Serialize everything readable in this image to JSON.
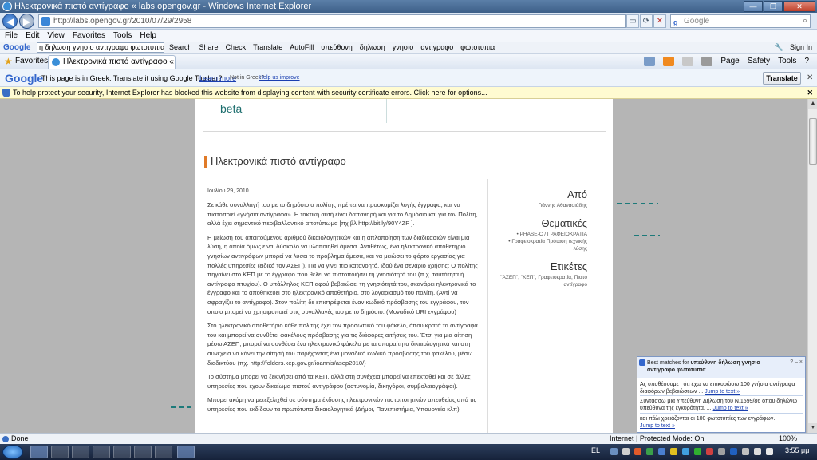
{
  "window": {
    "title": "Ηλεκτρονικά πιστό αντίγραφο « labs.opengov.gr - Windows Internet Explorer"
  },
  "address": {
    "url": "http://labs.opengov.gr/2010/07/29/2958"
  },
  "search_box": {
    "placeholder": "Google"
  },
  "menu": [
    "File",
    "Edit",
    "View",
    "Favorites",
    "Tools",
    "Help"
  ],
  "google_toolbar": {
    "logo": "Google",
    "query": "η δηλωση γνησιο αντιγραφο φωτοτυπια",
    "items": [
      "Search",
      "Share",
      "Check",
      "Translate",
      "AutoFill",
      "υπεύθυνη",
      "δηλωση",
      "γνησιο",
      "αντιγραφο",
      "φωτοτυπια"
    ],
    "sign_in": "Sign In"
  },
  "favorites_bar": {
    "favorites_label": "Favorites",
    "tab_title": "Ηλεκτρονικά πιστό αντίγραφο « labs...",
    "commands": [
      "Page",
      "Safety",
      "Tools"
    ]
  },
  "translate_bar": {
    "logo": "Google",
    "message": "This page is in Greek.  Translate it using Google Toolbar?",
    "learn_more": "Learn more",
    "not_greek": "Not in Greek?",
    "help_improve": "Help us improve",
    "button": "Translate"
  },
  "info_bar": {
    "text": "To help protect your security, Internet Explorer has blocked this website from displaying content with security certificate errors. Click here for options..."
  },
  "page": {
    "beta": "beta",
    "post_title": "Ηλεκτρονικά πιστό αντίγραφο",
    "date": "Ιουλίου 29, 2010",
    "paragraphs": [
      "Σε κάθε συναλλαγή του με το δημόσιο ο πολίτης πρέπει να προσκομίζει λογής έγγραφα, και να πιστοποιεί «γνήσια αντίγραφα». Η τακτική αυτή είναι δαπανηρή και για το Δημόσιο και για τον Πολίτη, αλλά έχει σημαντικό περιβαλλοντικό αποτύπωμα [πχ βλ http://bit.ly/90Y4ZP ].",
      "Η μείωση του απαιτούμενου αριθμού δικαιολογητικών και η απλοποίηση των διαδικασιών είναι μια λύση, η οποία όμως είναι δύσκολο να υλοποιηθεί άμεσα. Αντιθέτως, ένα ηλεκτρονικό αποθετήριο γνησίων αντιγράφων μπορεί να λύσει το πρόβλημα άμεσα, και να μειώσει το φόρτο εργασίας για πολλές υπηρεσίες (ειδικά τον ΑΣΕΠ). Για να γίνει πιο κατανοητό, ιδού ένα σενάριο χρήσης: Ο πολίτης πηγαίνει στο ΚΕΠ με το έγγραφο που θέλει να πιστοποιήσει τη γνησιότητά του (π.χ. ταυτότητα ή αντίγραφο πτυχίου). Ο υπάλληλος ΚΕΠ αφού βεβαιώσει τη γνησιότητά του, σκανάρει ηλεκτρονικά το έγγραφο και το αποθηκεύει στο ηλεκτρονικό αποθετήριο, στο λογαριασμό του πολίτη. (Αντί να σφραγίζει το αντίγραφο). Στον πολίτη δε επιστρέφεται έναν κωδικό πρόσβασης του εγγράφου, τον οποίο μπορεί να χρησιμοποιεί στις συναλλαγές του με το δημόσιο. (Μοναδικό URI εγγράφου)",
      "Στο ηλεκτρονικό αποθετήριο κάθε πολίτης έχει τον προσωπικό του φάκελο, όπου κρατά τα αντίγραφά του και μπορεί να συνθέτει φακέλους πρόσβασης για τις διάφορες αιτήσεις του. Έτσι για μια αίτηση μέσω ΑΣΕΠ, μπορεί να συνθέσει ένα ηλεκτρονικό φάκελο με τα απαραίτητα δικαιολογητικά και στη συνέχεια να κάνει την αίτησή του παρέχοντας ένα μοναδικό κωδικό πρόσβασης του φακέλου, μέσω διαδικτύου (πχ. http://folders.kep.gov.gr/ioannis/asep2010/)",
      "Το σύστημα μπορεί να ξεκινήσει από τα ΚΕΠ, αλλά στη συνέχεια μπορεί να επεκταθεί και σε άλλες υπηρεσίες που έχουν δικαίωμα πιστού αντιγράφου (αστυνομία, δικηγόροι, συμβολαιογράφοι).",
      "Μπορεί ακόμη να μετεξελιχθεί σε σύστημα έκδοσης ηλεκτρονικών πιστοποιητικών απευθείας από τις υπηρεσίες που εκδίδουν τα πρωτότυπα δικαιολογητικά (Δήμοι, Πανεπιστήμια, Υπουργεία κλπ)"
    ],
    "sidebar": {
      "from_heading": "Από",
      "author": "Γιάννης Αθανασιάδης",
      "topics_heading": "Θεματικές",
      "topics": [
        "PHASE-C / ΓΡΑΦΕΙΟΚΡΑΤΙΑ",
        "Γραφειοκρατία Πρόταση τεχνικής λύσης"
      ],
      "tags_heading": "Ετικέτες",
      "tags": "\"ΑΣΕΠ\", \"ΚΕΠ\", Γραφειοκρατία, Πιστό αντίγραφο"
    }
  },
  "best_matches": {
    "header_prefix": "Best matches for",
    "header_query": "υπεύθυνη δήλωση γνησιο αντιγραφο φωτοτυπια",
    "controls": "? – ×",
    "results": [
      {
        "text": "Ας υποθέσουμε , ότι έχω να επικυρώσω 100 γνήσια αντίγραφα διαφόρων βεβαιώσεων ...",
        "jump": "Jump to text »"
      },
      {
        "text": "Συντάσσω μια Υπεύθυνη Δήλωση του Ν.1599/86 όπου δηλώνω υπεύθυνα της εγκυρότητα, ...",
        "jump": "Jump to text »"
      },
      {
        "text": "και πάλι χρειάζονται οι 100 φωτοτυπίες των εγγράφων.",
        "jump": "Jump to text »"
      }
    ]
  },
  "status": {
    "text": "Done",
    "zone": "Internet | Protected Mode: On",
    "zoom": "100%"
  },
  "taskbar": {
    "language": "EL",
    "clock": "3:55 μμ"
  }
}
